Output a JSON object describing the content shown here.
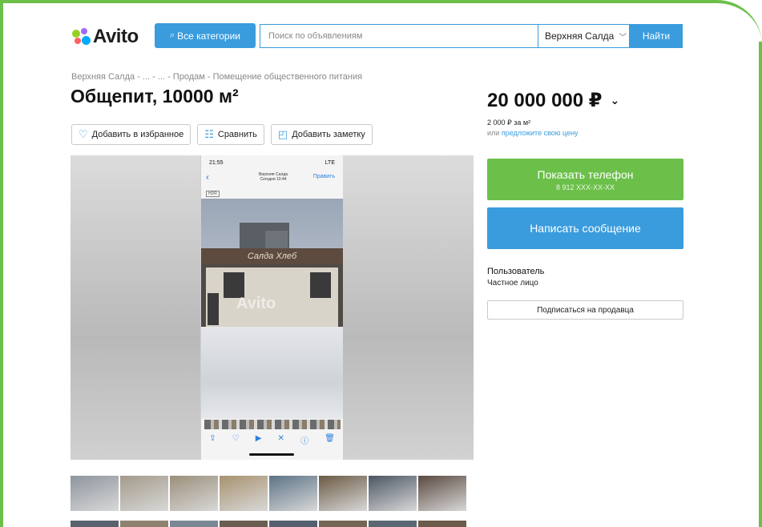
{
  "header": {
    "logo_text": "Avito",
    "categories_button": "Все категории",
    "search_placeholder": "Поиск по объявлениям",
    "region": "Верхняя Салда",
    "find_button": "Найти"
  },
  "listing": {
    "breadcrumb": "Верхняя Салда - ... - ... - Продам - Помещение общественного питания",
    "title": "Общепит, 10000 м²",
    "actions": {
      "favorite": "Добавить в избранное",
      "compare": "Сравнить",
      "note": "Добавить заметку"
    }
  },
  "photo": {
    "status_time": "21:55",
    "status_right": "LTE",
    "location_line1": "Верхняя Салда",
    "location_line2": "Сегодня 10:44",
    "edit": "Править",
    "hdr": "HDR",
    "sign_text": "Салда Хлеб",
    "watermark": "Avito"
  },
  "thumbnails": [
    {
      "color": "#8e959e"
    },
    {
      "color": "#a39a8a"
    },
    {
      "color": "#9b8f7a"
    },
    {
      "color": "#a8926f"
    },
    {
      "color": "#5c7386"
    },
    {
      "color": "#6b5a44"
    },
    {
      "color": "#4b5663"
    },
    {
      "color": "#5a4a40"
    }
  ],
  "thumbnails_row2": [
    {
      "color": "#5a6270"
    },
    {
      "color": "#8d8270"
    },
    {
      "color": "#7a8896"
    },
    {
      "color": "#6a5e50"
    },
    {
      "color": "#556070"
    },
    {
      "color": "#766655"
    },
    {
      "color": "#5b6773"
    },
    {
      "color": "#6c5a4a"
    }
  ],
  "sidebar": {
    "price": "20 000 000 ₽",
    "price_per_m": "2 000 ₽ за м²",
    "offer_prefix": "или ",
    "offer_link": "предложите свою цену",
    "show_phone": "Показать телефон",
    "phone_masked": "8 912 XXX-XX-XX",
    "write_message": "Написать сообщение",
    "seller_name": "Пользователь",
    "seller_type": "Частное лицо",
    "subscribe": "Подписаться на продавца"
  },
  "colors": {
    "frame_green": "#6cc04a",
    "accent_blue": "#3a9cdd",
    "phone_green": "#6cc04a"
  }
}
